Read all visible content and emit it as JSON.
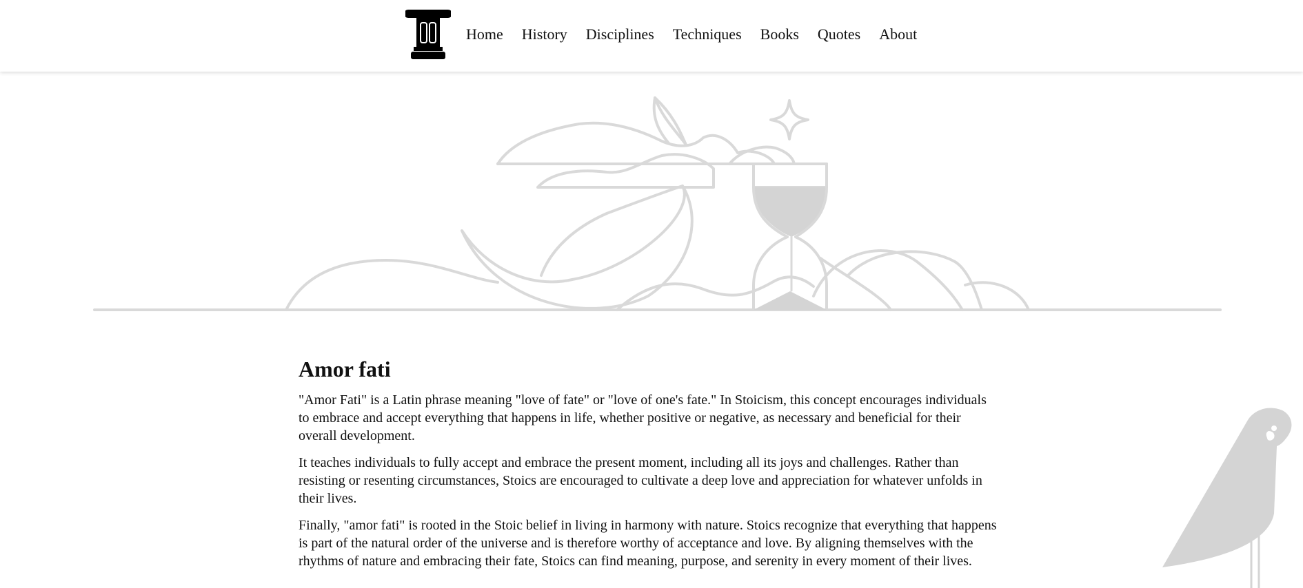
{
  "nav": {
    "logo": "column-logo-icon",
    "links": [
      {
        "label": "Home"
      },
      {
        "label": "History"
      },
      {
        "label": "Disciplines"
      },
      {
        "label": "Techniques"
      },
      {
        "label": "Books"
      },
      {
        "label": "Quotes"
      },
      {
        "label": "About"
      }
    ]
  },
  "hero": {
    "illustration": "hourglass-moon-clouds-illustration"
  },
  "article": {
    "title": "Amor fati",
    "paragraphs": [
      "\"Amor Fati\" is a Latin phrase meaning \"love of fate\" or \"love of one's fate.\" In Stoicism, this concept encourages individuals to embrace and accept everything that happens in life, whether positive or negative, as necessary and beneficial for their overall development.",
      "It teaches individuals to fully accept and embrace the present moment, including all its joys and challenges. Rather than resisting or resenting circumstances, Stoics are encouraged to cultivate a deep love and appreciation for whatever unfolds in their lives.",
      "Finally, \"amor fati\" is rooted in the Stoic belief in living in harmony with nature. Stoics recognize that everything that happens is part of the natural order of the universe and is therefore worthy of acceptance and love. By aligning themselves with the rhythms of nature and embracing their fate, Stoics can find meaning, purpose, and serenity in every moment of their lives."
    ]
  },
  "decorations": {
    "bird": "bird-illustration"
  },
  "colors": {
    "text": "#111111",
    "illustration": "#d9d9d9",
    "illustration_fill": "#d4d4d4",
    "logo": "#000000"
  }
}
